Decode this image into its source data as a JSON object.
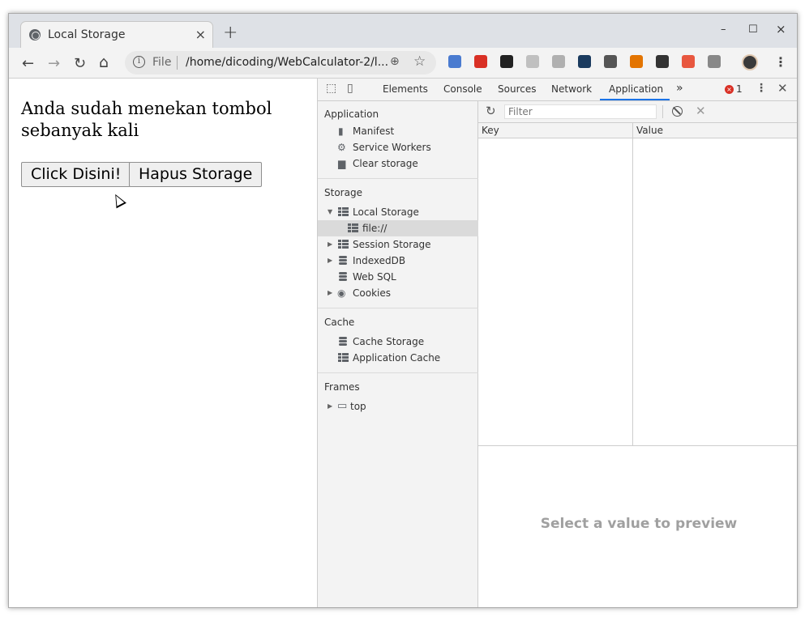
{
  "browser": {
    "tab_title": "Local Storage",
    "tab_close": "×",
    "new_tab": "+",
    "window_controls": {
      "minimize": "–",
      "maximize": "☐",
      "close": "×"
    },
    "omnibox": {
      "scheme": "File",
      "url": "/home/dicoding/WebCalculator-2/l..."
    },
    "nav": {
      "back": "←",
      "forward": "→",
      "reload": "↻",
      "home": "⌂"
    },
    "extensions": [
      {
        "name": "translate-icon",
        "color": "#4a7bd0"
      },
      {
        "name": "adblock-icon",
        "color": "#d93025"
      },
      {
        "name": "ext-3-icon",
        "color": "#222222"
      },
      {
        "name": "ext-4-icon",
        "color": "#c0c0c0"
      },
      {
        "name": "ext-5-icon",
        "color": "#b0b0b0"
      },
      {
        "name": "ext-6-icon",
        "color": "#1b3b5f"
      },
      {
        "name": "ext-7-icon",
        "color": "#555555"
      },
      {
        "name": "ext-8-icon",
        "color": "#e37400"
      },
      {
        "name": "ext-9-icon",
        "color": "#333333"
      },
      {
        "name": "ext-10-icon",
        "color": "#e8573f"
      },
      {
        "name": "ext-11-icon",
        "color": "#888888"
      }
    ]
  },
  "page": {
    "heading": "Anda sudah menekan tombol sebanyak kali",
    "click_button": "Click Disini!",
    "clear_button": "Hapus Storage"
  },
  "devtools": {
    "tabs": [
      "Elements",
      "Console",
      "Sources",
      "Network",
      "Application"
    ],
    "more": "»",
    "error_count": "1",
    "sidebar": {
      "application": {
        "title": "Application",
        "items": [
          "Manifest",
          "Service Workers",
          "Clear storage"
        ]
      },
      "storage": {
        "title": "Storage",
        "local_storage": "Local Storage",
        "local_file": "file://",
        "session_storage": "Session Storage",
        "indexeddb": "IndexedDB",
        "websql": "Web SQL",
        "cookies": "Cookies"
      },
      "cache": {
        "title": "Cache",
        "items": [
          "Cache Storage",
          "Application Cache"
        ]
      },
      "frames": {
        "title": "Frames",
        "top": "top"
      }
    },
    "filter_placeholder": "Filter",
    "table": {
      "key": "Key",
      "value": "Value"
    },
    "preview_text": "Select a value to preview"
  }
}
